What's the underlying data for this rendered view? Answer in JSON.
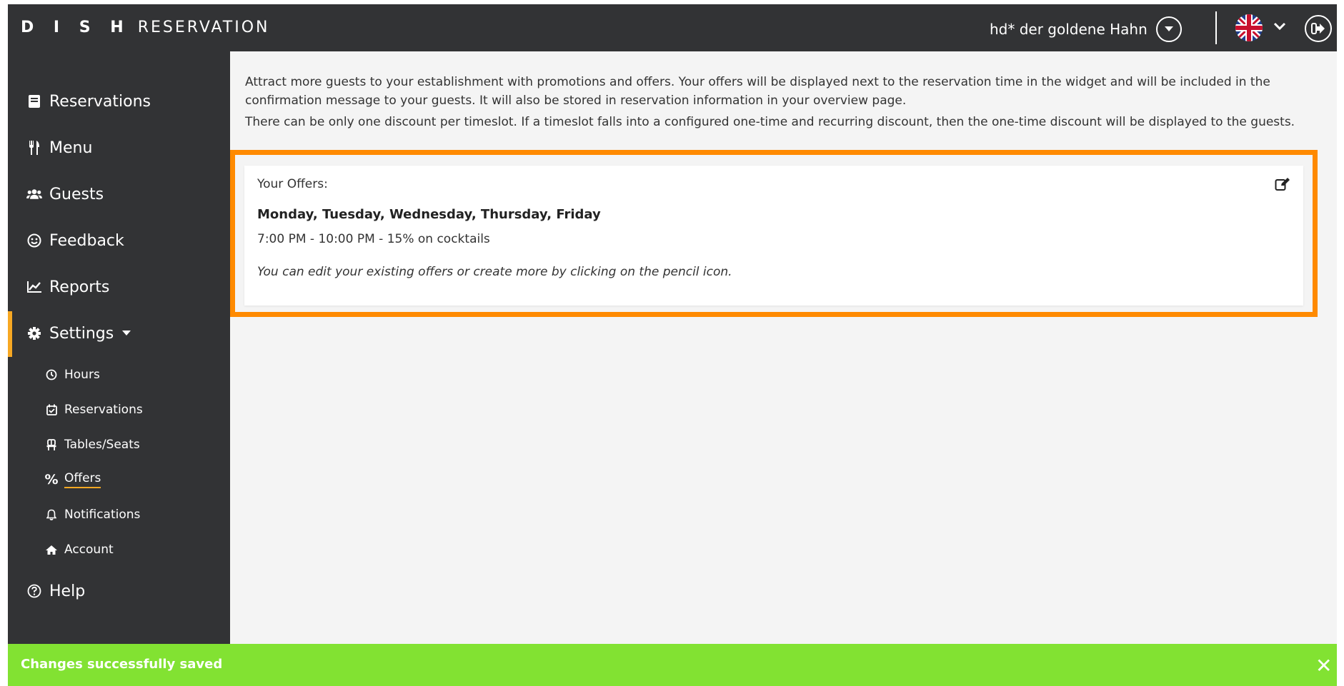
{
  "app": {
    "brand_bold": "D I S H",
    "brand_rest": "RESERVATION"
  },
  "header": {
    "restaurant_name": "hd* der goldene Hahn",
    "language_icon": "uk-flag-icon",
    "logout_icon": "logout-icon"
  },
  "sidebar": {
    "items": [
      {
        "label": "Reservations",
        "icon": "book-icon"
      },
      {
        "label": "Menu",
        "icon": "utensils-icon"
      },
      {
        "label": "Guests",
        "icon": "users-icon"
      },
      {
        "label": "Feedback",
        "icon": "smile-icon"
      },
      {
        "label": "Reports",
        "icon": "chart-icon"
      },
      {
        "label": "Settings",
        "icon": "gear-icon"
      },
      {
        "label": "Help",
        "icon": "question-circle-icon"
      }
    ],
    "settings_sub": [
      {
        "label": "Hours",
        "icon": "clock-icon"
      },
      {
        "label": "Reservations",
        "icon": "calendar-check-icon"
      },
      {
        "label": "Tables/Seats",
        "icon": "chair-icon"
      },
      {
        "label": "Offers",
        "icon": "percent-icon"
      },
      {
        "label": "Notifications",
        "icon": "bell-icon"
      },
      {
        "label": "Account",
        "icon": "home-icon"
      }
    ]
  },
  "main": {
    "intro_1": "Attract more guests to your establishment with promotions and offers. Your offers will be displayed next to the reservation time in the widget and will be included in the confirmation message to your guests. It will also be stored in reservation information in your overview page.",
    "intro_2": "There can be only one discount per timeslot. If a timeslot falls into a configured one-time and recurring discount, then the one-time discount will be displayed to the guests.",
    "offers": {
      "title": "Your Offers:",
      "days": "Monday, Tuesday, Wednesday, Thursday, Friday",
      "line": "7:00 PM - 10:00 PM - 15% on cocktails",
      "note": "You can edit your existing offers or create more by clicking on the pencil icon."
    },
    "help_fab": "?"
  },
  "toast": {
    "message": "Changes successfully saved",
    "close": "✕"
  },
  "colors": {
    "sidebar_bg": "#323335",
    "accent": "#f7a823",
    "highlight": "#ff8a00",
    "toast_bg": "#82e232",
    "help_bg": "#f9b51b"
  }
}
